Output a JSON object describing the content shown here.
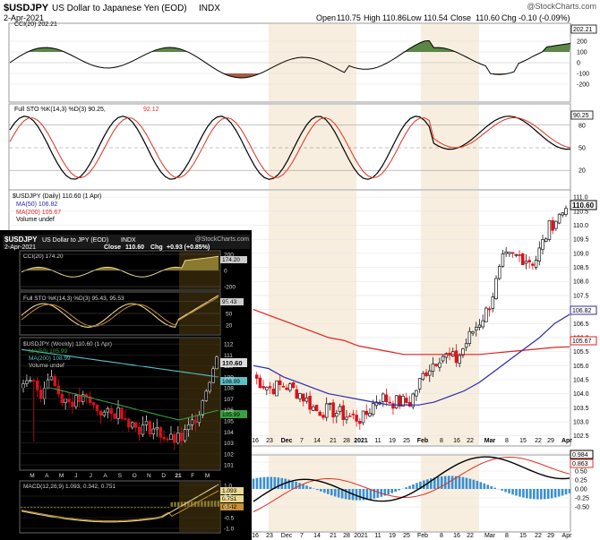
{
  "header": {
    "symbol": "$USDJPY",
    "name": "US Dollar to Japanese Yen (EOD)",
    "exchange": "INDX",
    "watermark": "@StockCharts.com",
    "date": "2-Apr-2021",
    "open_label": "Open",
    "open": "110.75",
    "high_label": "High",
    "high": "110.86",
    "low_label": "Low",
    "low": "110.54",
    "close_label": "Close",
    "close": "110.60",
    "chg_label": "Chg",
    "chg": "-0.10 (-0.09%)"
  },
  "colors": {
    "up": "#111111",
    "down": "#e0101a",
    "ma50": "#2a2ab0",
    "ma200": "#e02020",
    "panel_bg": "#ffffff",
    "inset_bg": "#000000",
    "shade": "#f3e0c4",
    "pos_fill": "#4a7a34",
    "neg_fill": "#a04830",
    "sig": "#e03020",
    "hist": "#3a8fd0"
  },
  "cci_panel": {
    "legend": "CCI(20) 202.21",
    "value_tag": "202.21",
    "ticks": [
      "200",
      "100",
      "0",
      "-100",
      "-200"
    ]
  },
  "sto_panel": {
    "legend_main": "Full STO %K(14,3) %D(3) 90.25,",
    "legend_d": "92.12",
    "value_tag": "90.25",
    "ticks": [
      "80",
      "50",
      "20"
    ]
  },
  "price_panel": {
    "legend_main": "$USDJPY (Daily) 110.60 (1 Apr)",
    "legend_ma50": "MA(50) 106.82",
    "legend_ma200": "MA(200) 105.67",
    "legend_vol": "Volume undef",
    "price_tag": "110.60",
    "ma50_tag": "106.82",
    "ma200_tag": "105.67",
    "ticks": [
      "111.0",
      "110.5",
      "110.0",
      "109.5",
      "109.0",
      "108.5",
      "108.0",
      "107.5",
      "107.0",
      "106.5",
      "106.0",
      "105.5",
      "105.0",
      "104.5",
      "104.0",
      "103.5",
      "103.0",
      "102.5"
    ]
  },
  "bottom_panel": {
    "ticks": [
      "1.00",
      "0.75",
      "0.50",
      "0.25",
      "0.00",
      "-0.25",
      "-0.50"
    ],
    "tag_main": "0.984",
    "tag_sig": "0.863"
  },
  "x_axis": {
    "labels": [
      "16",
      "23",
      "Dec",
      "7",
      "14",
      "21",
      "28",
      "2021",
      "11",
      "19",
      "25",
      "Feb",
      "8",
      "16",
      "22",
      "Mar",
      "8",
      "15",
      "22",
      "29",
      "Apr"
    ]
  },
  "inset": {
    "title_symbol": "$USDJPY",
    "title_name": "US Dollar to JPY (EOD)",
    "title_exchange": "INDX",
    "watermark": "@StockCharts.com",
    "date": "2-Apr-2021",
    "close_label": "Close",
    "close": "110.60",
    "chg_label": "Chg",
    "chg": "+0.93 (+0.85%)",
    "cci_legend": "CCI(20) 174.20",
    "cci_tag": "174.20",
    "cci_ticks": [
      "200",
      "0",
      "-200"
    ],
    "sto_legend": "Full STO %K(14,3) %D(3) 95.43, 95.53",
    "sto_tag": "95.43",
    "sto_ticks": [
      "80",
      "50",
      "20"
    ],
    "price_legend": "$USDJPY (Weekly) 110.60 (1 Apr)",
    "ma50_legend": "MA(50) 105.99",
    "ma200_legend": "MA(200) 108.99",
    "vol_legend": "Volume undef",
    "price_tag": "110.60",
    "ma200_tag": "108.99",
    "ma50_tag": "105.99",
    "price_ticks": [
      "112",
      "111",
      "110",
      "109",
      "108",
      "107",
      "106",
      "105",
      "104",
      "103",
      "102",
      "101"
    ],
    "x_labels": [
      "M",
      "A",
      "M",
      "J",
      "J",
      "A",
      "S",
      "O",
      "N",
      "D",
      "21",
      "F",
      "M"
    ],
    "macd_legend": "MACD(12,26,9) 1.093, 0.342, 0.751",
    "macd_tags": [
      "1.093",
      "0.751",
      "0.342"
    ],
    "macd_ticks": [
      "1.0",
      "0.5",
      "0.0",
      "-0.5",
      "-1.0"
    ]
  },
  "chart_data": {
    "type": "line",
    "title": "$USDJPY US Dollar to Japanese Yen (EOD) INDX",
    "series": [
      {
        "name": "$USDJPY (Daily)",
        "x": [
          "Nov 16",
          "Nov 23",
          "Dec 1",
          "Dec 7",
          "Dec 14",
          "Dec 21",
          "Dec 28",
          "Jan 4",
          "Jan 11",
          "Jan 19",
          "Jan 25",
          "Feb 1",
          "Feb 8",
          "Feb 16",
          "Feb 22",
          "Mar 1",
          "Mar 8",
          "Mar 15",
          "Mar 22",
          "Mar 29",
          "Apr 1"
        ],
        "values": [
          104.6,
          104.2,
          104.3,
          104.0,
          103.4,
          103.4,
          103.2,
          103.1,
          103.9,
          103.7,
          103.7,
          104.8,
          105.4,
          105.2,
          106.2,
          107.0,
          108.8,
          108.9,
          108.7,
          110.0,
          110.6
        ]
      },
      {
        "name": "MA(50)",
        "values": [
          104.9,
          104.6,
          104.4,
          104.2,
          104.0,
          103.9,
          103.8,
          103.7,
          103.6,
          103.6,
          103.6,
          103.7,
          103.9,
          104.1,
          104.4,
          104.8,
          105.2,
          105.6,
          106.0,
          106.5,
          106.82
        ]
      },
      {
        "name": "MA(200)",
        "values": [
          106.8,
          106.6,
          106.4,
          106.2,
          106.0,
          105.9,
          105.7,
          105.6,
          105.5,
          105.4,
          105.4,
          105.4,
          105.4,
          105.4,
          105.4,
          105.45,
          105.5,
          105.55,
          105.6,
          105.65,
          105.67
        ]
      }
    ],
    "ylim": [
      102.3,
      111.1
    ]
  }
}
